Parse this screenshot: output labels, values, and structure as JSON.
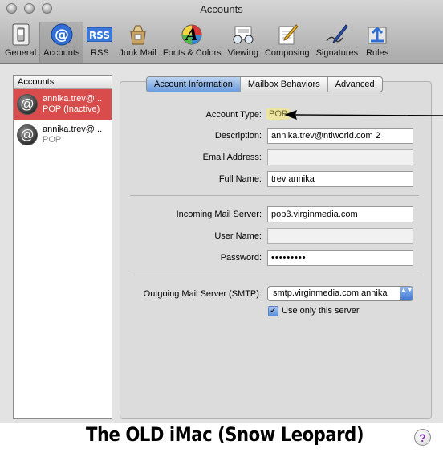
{
  "window": {
    "title": "Accounts"
  },
  "toolbar": {
    "items": [
      {
        "label": "General",
        "icon": "light-switch-icon"
      },
      {
        "label": "Accounts",
        "icon": "at-sign-icon"
      },
      {
        "label": "RSS",
        "icon": "rss-icon"
      },
      {
        "label": "Junk Mail",
        "icon": "junk-mail-bag-icon"
      },
      {
        "label": "Fonts & Colors",
        "icon": "font-palette-icon"
      },
      {
        "label": "Viewing",
        "icon": "glasses-icon"
      },
      {
        "label": "Composing",
        "icon": "pencil-paper-icon"
      },
      {
        "label": "Signatures",
        "icon": "pen-signature-icon"
      },
      {
        "label": "Rules",
        "icon": "rules-arrows-icon"
      }
    ],
    "selected": "Accounts"
  },
  "sidebar": {
    "header": "Accounts",
    "accounts": [
      {
        "name": "annika.trev@...",
        "type": "POP (Inactive)"
      },
      {
        "name": "annika.trev@...",
        "type": "POP"
      }
    ],
    "add_label": "+",
    "remove_label": "−"
  },
  "tabs": [
    "Account Information",
    "Mailbox Behaviors",
    "Advanced"
  ],
  "form": {
    "account_type_label": "Account Type:",
    "account_type_value": "POP",
    "description_label": "Description:",
    "description_value": "annika.trev@ntlworld.com 2",
    "email_label": "Email Address:",
    "email_value": "",
    "fullname_label": "Full Name:",
    "fullname_value": "trev annika",
    "incoming_label": "Incoming Mail Server:",
    "incoming_value": "pop3.virginmedia.com",
    "username_label": "User Name:",
    "username_value": "",
    "password_label": "Password:",
    "password_value": "•••••••••",
    "smtp_label": "Outgoing Mail Server (SMTP):",
    "smtp_value": "smtp.virginmedia.com:annika",
    "only_server_label": "Use only this server",
    "only_server_checked": true
  },
  "caption": "The OLD iMac (Snow Leopard)",
  "help_label": "?",
  "checkmark": "✓",
  "select_arrows": "▲▼"
}
